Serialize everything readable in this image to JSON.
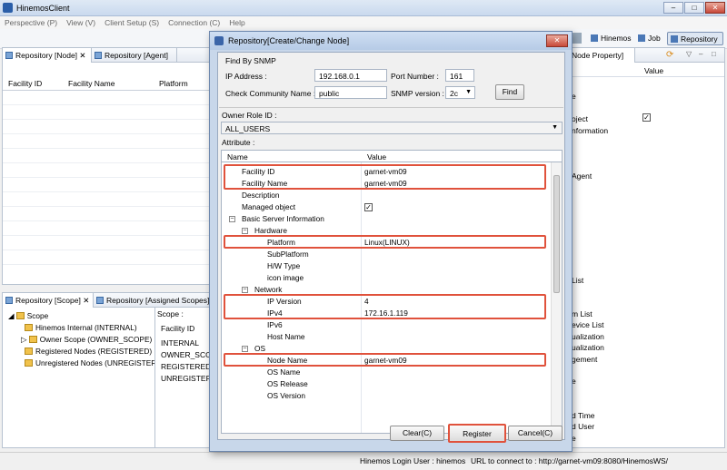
{
  "app": {
    "title": "HinemosClient",
    "window_buttons": [
      "–",
      "□",
      "✕"
    ]
  },
  "menu": [
    "Perspective (P)",
    "View (V)",
    "Client Setup (S)",
    "Connection (C)",
    "Help"
  ],
  "perspectives": {
    "hinemos": "Hinemos",
    "job": "Job",
    "repository": "Repository"
  },
  "left_top": {
    "tabs": [
      "Repository [Node]",
      "Repository [Agent]"
    ],
    "columns": [
      "Facility ID",
      "Facility Name",
      "Platform"
    ]
  },
  "left_bottom": {
    "tabs": [
      "Repository [Scope]",
      "Repository [Assigned Scopes]"
    ],
    "tree": [
      "Scope",
      "Hinemos Internal (INTERNAL)",
      "Owner Scope (OWNER_SCOPE)",
      "Registered Nodes (REGISTERED)",
      "Unregistered Nodes (UNREGISTERE"
    ],
    "scope_header": "Scope :",
    "facility_header": "Facility ID",
    "facility_ids": [
      "INTERNAL",
      "OWNER_SCOP",
      "REGISTERED",
      "UNREGISTERED"
    ]
  },
  "right": {
    "tab": "Node Property]",
    "value_header": "Value",
    "fragments": [
      "e",
      "oject",
      "nformation",
      "Agent",
      "List",
      "m List",
      "evice List",
      "ualization",
      "ualization",
      "gement",
      "e",
      "d Time",
      "d User",
      "e"
    ]
  },
  "dialog": {
    "title": "Repository[Create/Change Node]",
    "find_group": "Find By SNMP",
    "ip_label": "IP Address :",
    "ip_value": "192.168.0.1",
    "port_label": "Port Number :",
    "port_value": "161",
    "community_label": "Check Community Name :",
    "community_value": "public",
    "snmp_version_label": "SNMP version :",
    "snmp_version_value": "2c",
    "find_button": "Find",
    "owner_role_label": "Owner Role ID :",
    "owner_role_value": "ALL_USERS",
    "attribute_label": "Attribute :",
    "col_name": "Name",
    "col_value": "Value",
    "rows": [
      {
        "name": "Facility ID",
        "value": "garnet-vm09"
      },
      {
        "name": "Facility Name",
        "value": "garnet-vm09"
      },
      {
        "name": "Description",
        "value": ""
      },
      {
        "name": "Managed object",
        "value": ""
      },
      {
        "name": "Basic Server Information",
        "value": ""
      },
      {
        "name": "Hardware",
        "value": ""
      },
      {
        "name": "Platform",
        "value": "Linux(LINUX)"
      },
      {
        "name": "SubPlatform",
        "value": ""
      },
      {
        "name": "H/W Type",
        "value": ""
      },
      {
        "name": "icon image",
        "value": ""
      },
      {
        "name": "Network",
        "value": ""
      },
      {
        "name": "IP Version",
        "value": "4"
      },
      {
        "name": "IPv4",
        "value": "172.16.1.119"
      },
      {
        "name": "IPv6",
        "value": ""
      },
      {
        "name": "Host Name",
        "value": ""
      },
      {
        "name": "OS",
        "value": ""
      },
      {
        "name": "Node Name",
        "value": "garnet-vm09"
      },
      {
        "name": "OS Name",
        "value": ""
      },
      {
        "name": "OS Release",
        "value": ""
      },
      {
        "name": "OS Version",
        "value": ""
      }
    ],
    "clear_button": "Clear(C)",
    "register_button": "Register",
    "cancel_button": "Cancel(C)"
  },
  "status": {
    "login_user": "Hinemos Login User : hinemos",
    "url": "URL to connect to : http://garnet-vm09:8080/HinemosWS/"
  },
  "colors": {
    "highlight": "#e0523c",
    "dialog_frame": "#c8d7ea"
  }
}
